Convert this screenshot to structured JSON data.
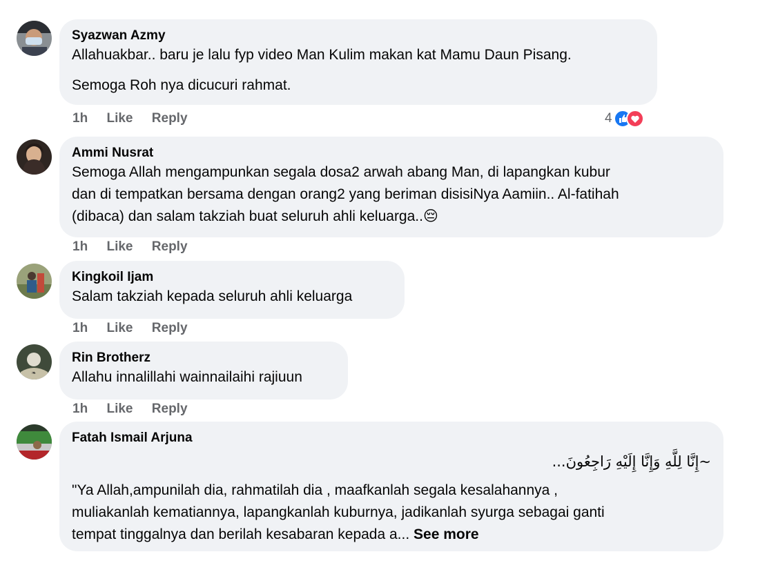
{
  "comments": [
    {
      "author": "Syazwan Azmy",
      "lines": [
        "Allahuakbar.. baru je lalu fyp video Man Kulim makan kat Mamu Daun Pisang.",
        "Semoga Roh nya dicucuri rahmat."
      ],
      "time": "1h",
      "like": "Like",
      "reply": "Reply",
      "reaction_count": "4"
    },
    {
      "author": "Ammi Nusrat",
      "lines": [
        "Semoga Allah mengampunkan segala dosa2 arwah abang Man, di lapangkan kubur",
        "dan di tempatkan bersama dengan orang2 yang beriman disisiNya Aamiin.. Al-fatihah",
        "(dibaca) dan salam takziah buat seluruh ahli keluarga.."
      ],
      "emoji": "😔",
      "time": "1h",
      "like": "Like",
      "reply": "Reply"
    },
    {
      "author": "Kingkoil Ijam",
      "lines": [
        "Salam takziah kepada seluruh ahli keluarga"
      ],
      "time": "1h",
      "like": "Like",
      "reply": "Reply"
    },
    {
      "author": "Rin Brotherz",
      "lines": [
        "Allahu innalillahi wainnailaihi rajiuun"
      ],
      "time": "1h",
      "like": "Like",
      "reply": "Reply"
    },
    {
      "author": "Fatah Ismail Arjuna",
      "arabic": "~إِنَّا لِلَّهِ وَإِنَّا إِلَيْهِ رَاجِعُونَ...",
      "lines": [
        "\"Ya Allah,ampunilah dia, rahmatilah dia , maafkanlah segala kesalahannya ,",
        "muliakanlah kematiannya, lapangkanlah kuburnya, jadikanlah syurga sebagai ganti",
        "tempat tinggalnya dan berilah kesabaran kepada a..."
      ],
      "see_more": "See more"
    }
  ],
  "colors": {
    "bubble": "#f0f2f5",
    "meta": "#65676b",
    "like_blue": "#1877f2",
    "love_red": "#f33e58"
  },
  "icons": [
    "like-reaction-icon",
    "love-reaction-icon"
  ]
}
